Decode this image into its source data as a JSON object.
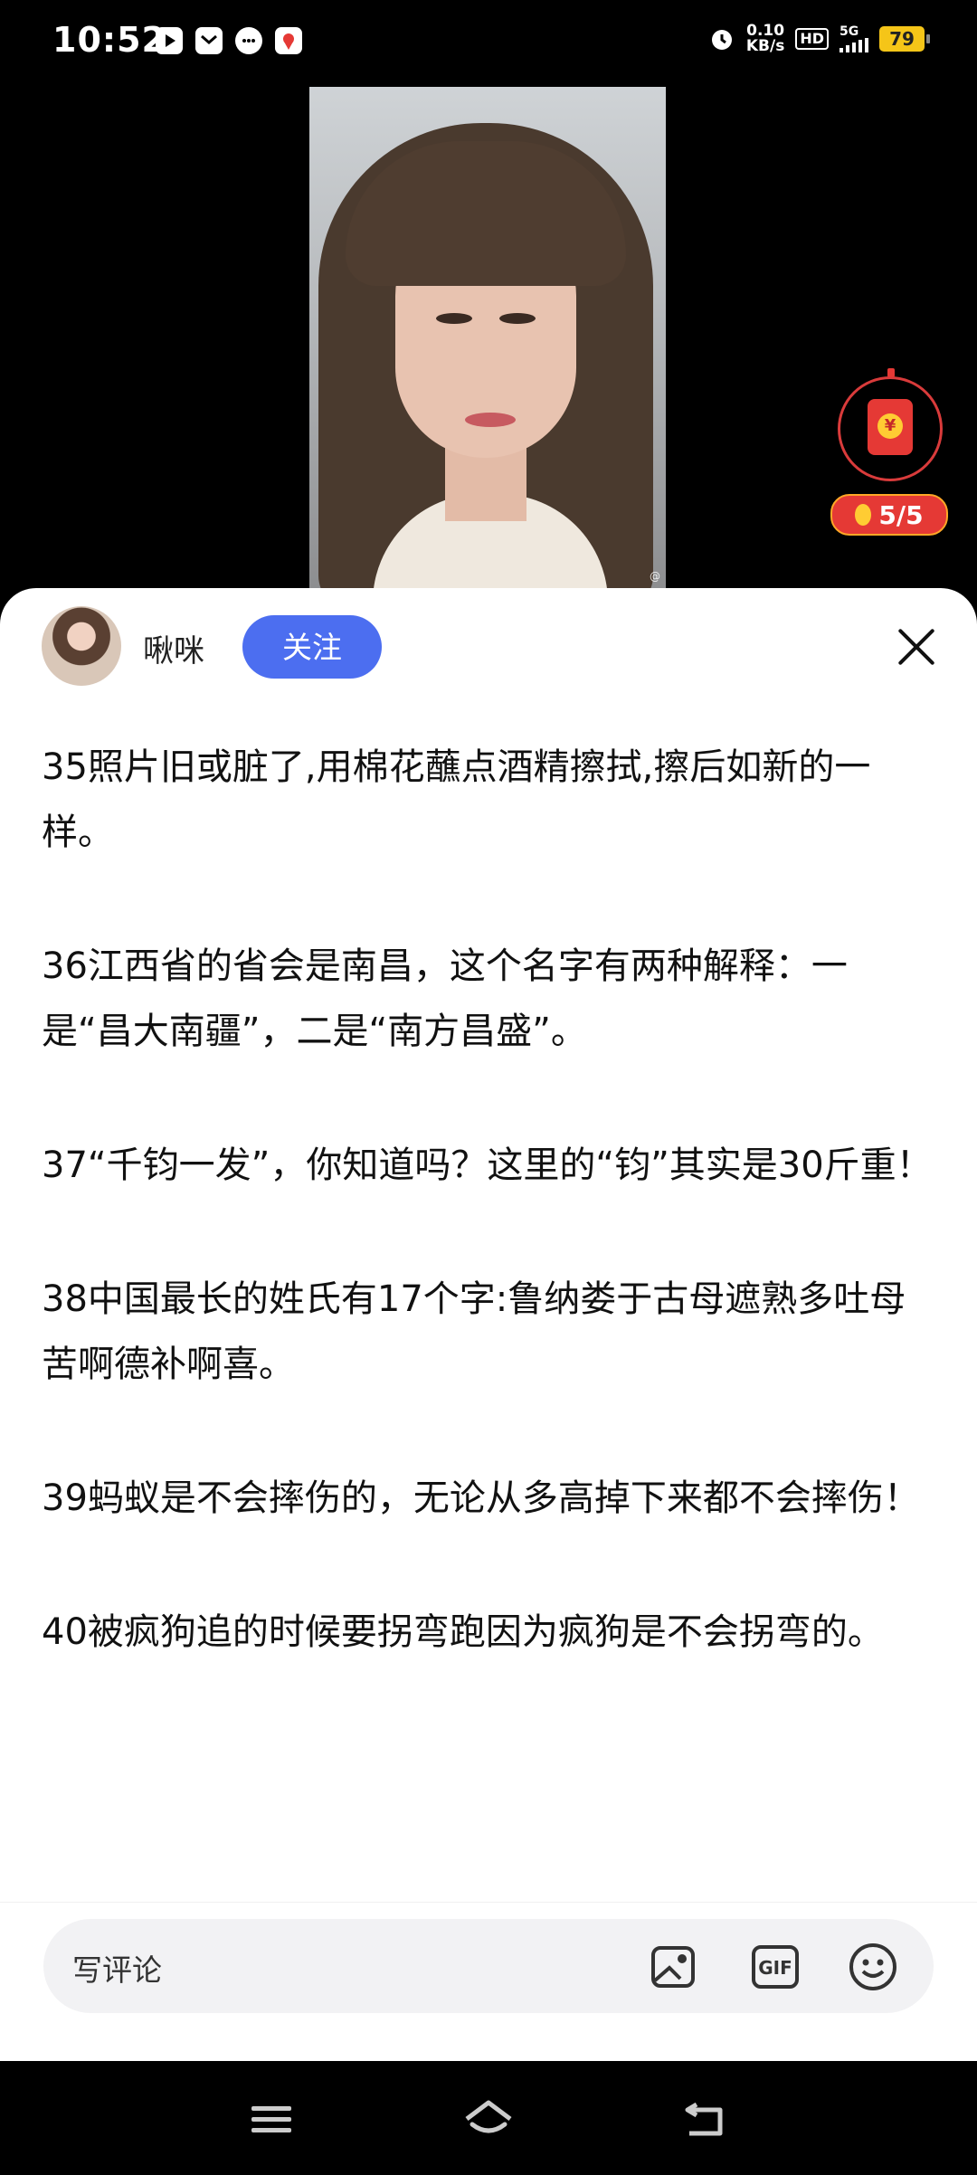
{
  "status_bar": {
    "time": "10:52",
    "net_speed_value": "0.10",
    "net_speed_unit": "KB/s",
    "hd_label": "HD",
    "network_label": "5G",
    "battery_level": "79"
  },
  "video": {
    "watermark": "@"
  },
  "reward": {
    "packet_symbol": "¥",
    "counter": "5/5"
  },
  "author": {
    "name": "啾咪",
    "follow_label": "关注"
  },
  "post": {
    "paragraphs": [
      "35照片旧或脏了,用棉花蘸点酒精擦拭,擦后如新的一样。",
      "36江西省的省会是南昌，这个名字有两种解释：一是“昌大南疆”，二是“南方昌盛”。",
      "37“千钧一发”，你知道吗？这里的“钧”其实是30斤重！",
      "38中国最长的姓氏有17个字:鲁纳娄于古母遮熟多吐母苦啊德补啊喜。",
      "39蚂蚁是不会摔伤的，无论从多高掉下来都不会摔伤！",
      "40被疯狗追的时候要拐弯跑因为疯狗是不会拐弯的。"
    ]
  },
  "comment_bar": {
    "placeholder": "写评论",
    "gif_label": "GIF"
  },
  "colors": {
    "follow_button": "#4c6ef0",
    "red_packet": "#e53935",
    "battery": "#f5c518"
  }
}
